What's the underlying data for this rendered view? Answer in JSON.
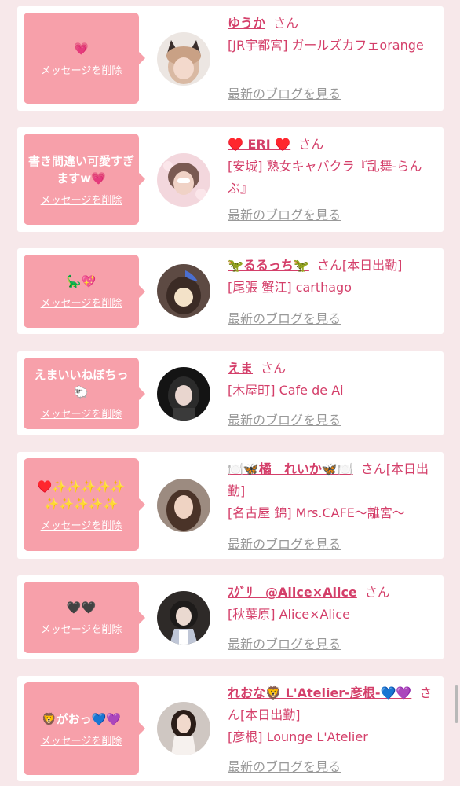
{
  "cards": [
    {
      "message": "💗",
      "delete_label": "メッセージを削除",
      "name": "ゆうか",
      "suffix": "さん",
      "extra": "",
      "shop": "[JR宇都宮] ガールズカフェorange",
      "blog_link": "最新のブログを見る",
      "avatar": "avatar-girl-cat-ears"
    },
    {
      "message": "書き間違い可愛すぎますw💗",
      "delete_label": "メッセージを削除",
      "name": "♥️ ERI ♥️",
      "suffix": "さん",
      "extra": "",
      "shop": "[安城] 熟女キャバクラ『乱舞-らんぶ』",
      "blog_link": "最新のブログを見る",
      "avatar": "avatar-girl-pink-bg"
    },
    {
      "message": "🦕💖",
      "delete_label": "メッセージを削除",
      "name": "🦖るるっち🦖",
      "suffix": "さん",
      "extra": "[本日出勤]",
      "shop": "[尾張 蟹江] carthago",
      "blog_link": "最新のブログを見る",
      "avatar": "avatar-girl-face-sticker"
    },
    {
      "message": "えまいいねぼちっ🐑",
      "delete_label": "メッセージを削除",
      "name": "えま",
      "suffix": "さん",
      "extra": "",
      "shop": "[木屋町] Cafe de Ai",
      "blog_link": "最新のブログを見る",
      "avatar": "avatar-girl-dark-hair"
    },
    {
      "message": "♥️✨✨✨✨✨✨✨✨✨✨",
      "delete_label": "メッセージを削除",
      "name": "🍽️🦋橘　れいか🦋🍽️",
      "suffix": "さん",
      "extra": "[本日出勤]",
      "shop": "[名古屋 錦] Mrs.CAFE〜離宮〜",
      "blog_link": "最新のブログを見る",
      "avatar": "avatar-woman-long-hair"
    },
    {
      "message": "🖤🖤",
      "delete_label": "メッセージを削除",
      "name": "ｽｸﾞﾘ　@Alice×Alice",
      "suffix": "さん",
      "extra": "",
      "shop": "[秋葉原] Alice×Alice",
      "blog_link": "最新のブログを見る",
      "avatar": "avatar-maid-cosplay"
    },
    {
      "message": "🦁がおっ💙💜",
      "delete_label": "メッセージを削除",
      "name": "れおな🦁 L'Atelier-彦根-💙💜",
      "suffix": "さん",
      "extra": "[本日出勤]",
      "shop": "[彦根] Lounge L'Atelier",
      "blog_link": "最新のブログを見る",
      "avatar": "avatar-woman-white-outfit"
    }
  ]
}
